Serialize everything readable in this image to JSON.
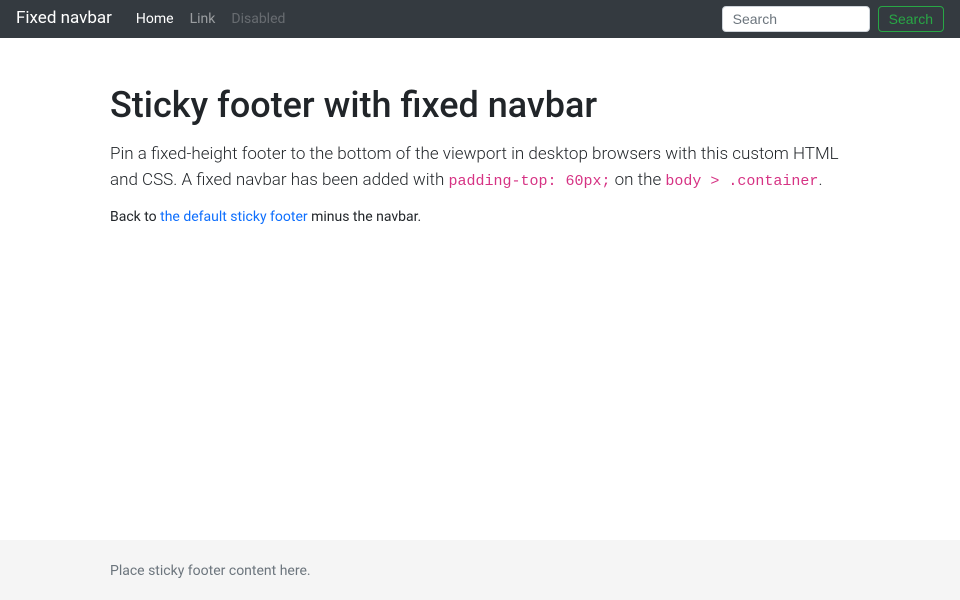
{
  "navbar": {
    "brand": "Fixed navbar",
    "links": [
      {
        "label": "Home"
      },
      {
        "label": "Link"
      },
      {
        "label": "Disabled"
      }
    ],
    "search": {
      "placeholder": "Search",
      "button_label": "Search"
    }
  },
  "main": {
    "heading": "Sticky footer with fixed navbar",
    "lead_part1": "Pin a fixed-height footer to the bottom of the viewport in desktop browsers with this custom HTML and CSS. A fixed navbar has been added with ",
    "code1": "padding-top: 60px;",
    "lead_part2": " on the ",
    "code2": "body > .container",
    "lead_part3": ".",
    "back_prefix": "Back to ",
    "back_link_text": "the default sticky footer",
    "back_suffix": " minus the navbar."
  },
  "footer": {
    "text": "Place sticky footer content here."
  }
}
